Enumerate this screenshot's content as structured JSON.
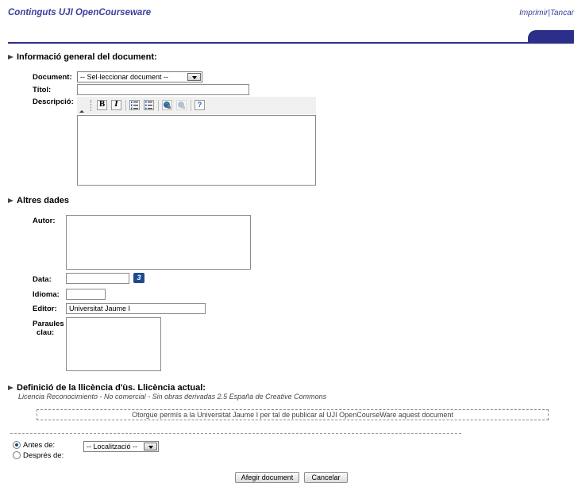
{
  "header": {
    "site_title": "Continguts UJI OpenCourseware",
    "link_print": "Imprimir",
    "link_separator": "|",
    "link_close": "Tancar"
  },
  "section_general": {
    "title": "Informació general del document:",
    "document_label": "Document:",
    "document_select_value": "-- Sel·leccionar document --",
    "title_label": "Títol:",
    "title_value": "",
    "description_label": "Descripció:",
    "description_value": "",
    "editor_toolbar": [
      "bold-icon",
      "italic-icon",
      "ordered-list-icon",
      "unordered-list-icon",
      "link-icon",
      "unlink-icon",
      "help-icon"
    ]
  },
  "section_other": {
    "title": "Altres dades",
    "author_label": "Autor:",
    "author_value": "",
    "date_label": "Data:",
    "date_value": "",
    "calendar_glyph": "3",
    "language_label": "Idioma:",
    "language_value": "",
    "publisher_label": "Editor:",
    "publisher_value": "Universitat Jaume I",
    "keywords_label_1": "Paraules",
    "keywords_label_2": "clau:",
    "keywords_value": ""
  },
  "section_license": {
    "title": "Definició de la llicència d'ùs. Llicència actual:",
    "current_license": "Licencia Reconocimiento - No comercial - Sin obras derivadas 2.5 España de Creative Commons",
    "consent_text": "Otorgue permís a la Universitat Jaume I per tal de publicar al UJI OpenCourseWare aquest document"
  },
  "position": {
    "before_label": "Antes de:",
    "after_label": "Després de:",
    "before_selected": true,
    "location_select_value": "-- Localització --"
  },
  "actions": {
    "add_label": "Afegir document",
    "cancel_label": "Cancelar"
  },
  "colors": {
    "brand": "#3a3f9a",
    "header_bar": "#2b2f8a"
  }
}
